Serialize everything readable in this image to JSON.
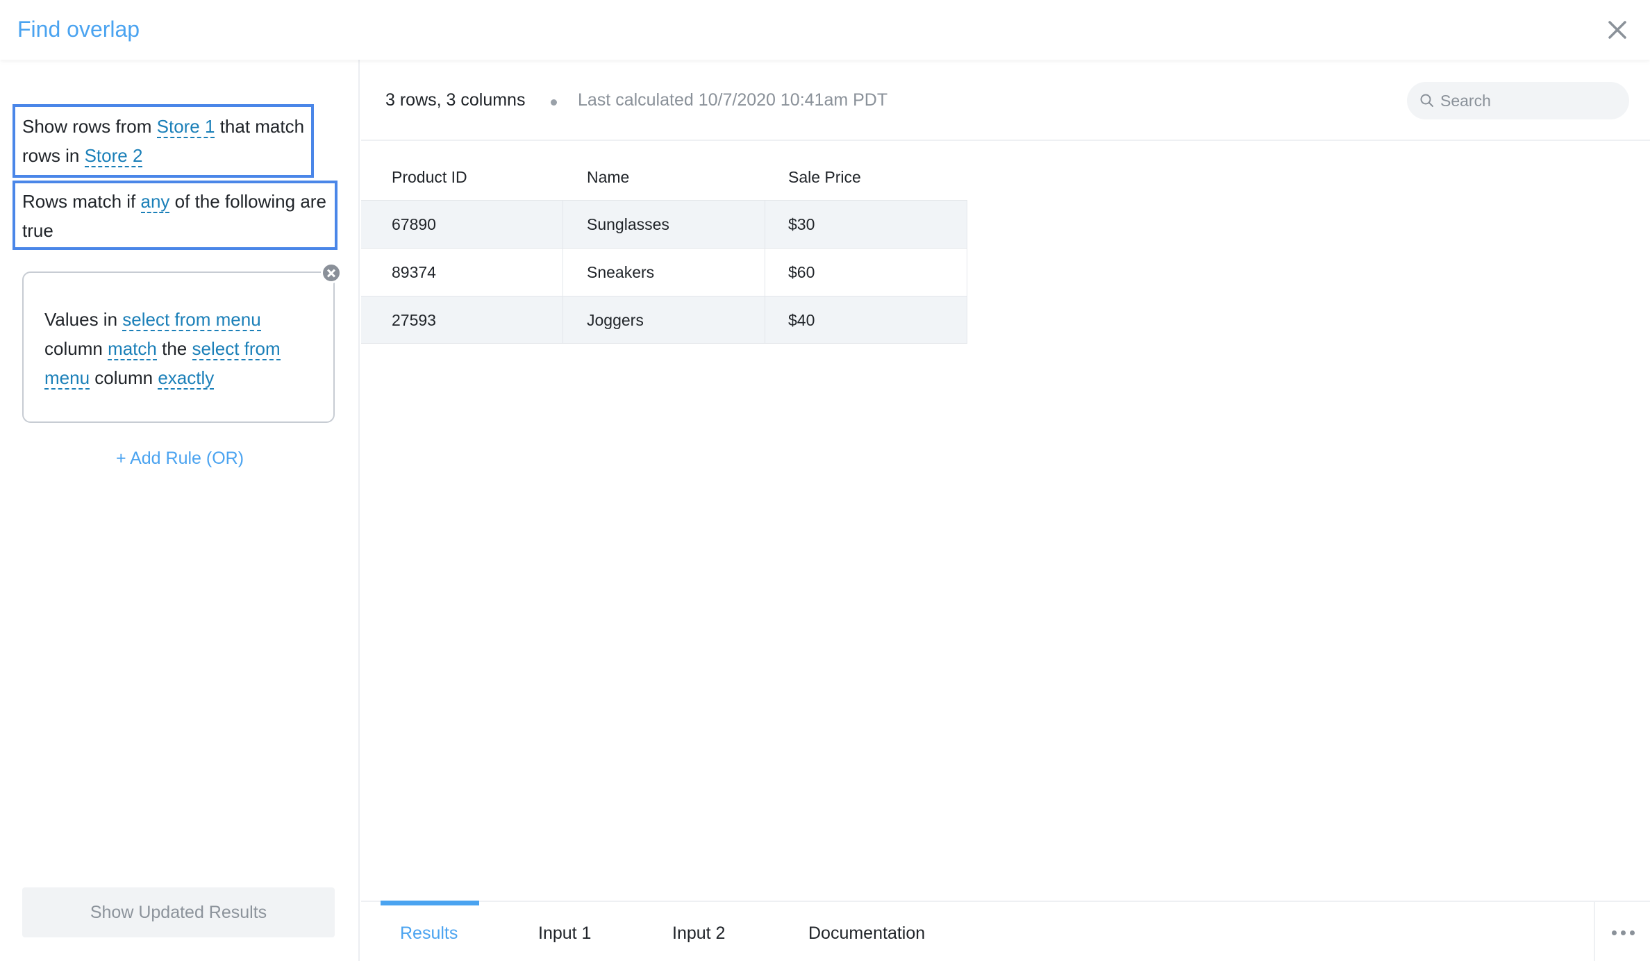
{
  "header": {
    "title": "Find overlap",
    "close_icon": "close-icon"
  },
  "sidebar": {
    "statement1": {
      "prefix": "Show rows from",
      "source": "Store 1",
      "middle": "that match rows in",
      "target": "Store 2"
    },
    "statement2": {
      "prefix": "Rows match if",
      "condition": "any",
      "suffix": "of the following are true"
    },
    "rule": {
      "part1": "Values in",
      "column1": "select from menu",
      "part2": "column",
      "operator": "match",
      "part3": "the",
      "column2": "select from menu",
      "part4": "column",
      "mode": "exactly"
    },
    "add_rule_label": "+ Add Rule (OR)",
    "show_results_label": "Show Updated Results"
  },
  "summary": {
    "row_count": "3 rows, 3 columns",
    "last_calculated": "Last calculated 10/7/2020 10:41am PDT"
  },
  "search": {
    "placeholder": "Search",
    "value": ""
  },
  "table": {
    "headers": [
      "Product ID",
      "Name",
      "Sale Price"
    ],
    "rows": [
      [
        "67890",
        "Sunglasses",
        "$30"
      ],
      [
        "89374",
        "Sneakers",
        "$60"
      ],
      [
        "27593",
        "Joggers",
        "$40"
      ]
    ]
  },
  "tabs": [
    {
      "label": "Results",
      "active": true
    },
    {
      "label": "Input 1",
      "active": false
    },
    {
      "label": "Input 2",
      "active": false
    },
    {
      "label": "Documentation",
      "active": false
    }
  ],
  "colors": {
    "accent": "#4aa3f0",
    "highlight_border": "#4a86e8",
    "link": "#1a7fb8"
  }
}
